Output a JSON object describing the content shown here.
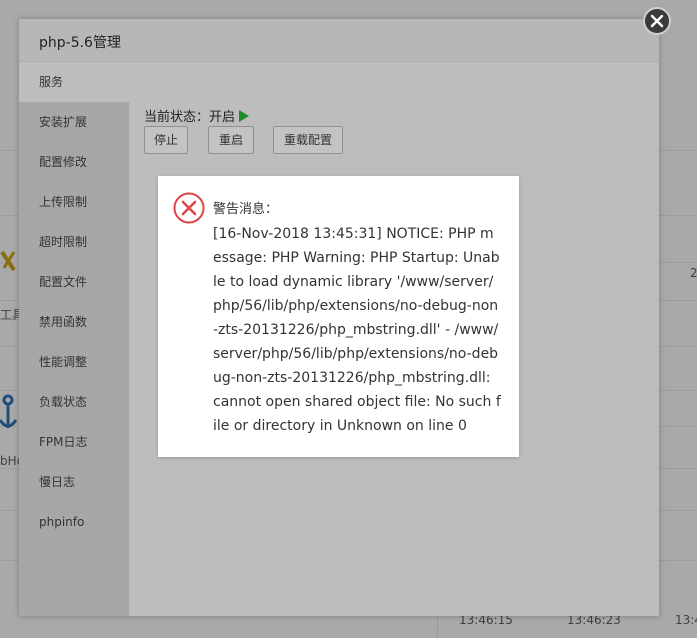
{
  "background": {
    "left_labels": [
      "工具",
      "bHo"
    ],
    "right_number": "2",
    "time_labels": [
      "13:46:15",
      "13:46:23",
      "13:4"
    ]
  },
  "modal": {
    "title": "php-5.6管理",
    "sidebar": [
      {
        "label": "服务",
        "active": true
      },
      {
        "label": "安装扩展"
      },
      {
        "label": "配置修改"
      },
      {
        "label": "上传限制"
      },
      {
        "label": "超时限制"
      },
      {
        "label": "配置文件"
      },
      {
        "label": "禁用函数"
      },
      {
        "label": "性能调整"
      },
      {
        "label": "负载状态"
      },
      {
        "label": "FPM日志"
      },
      {
        "label": "慢日志"
      },
      {
        "label": "phpinfo"
      }
    ],
    "status_text": "当前状态：开启",
    "buttons": {
      "stop": "停止",
      "restart": "重启",
      "reload": "重载配置"
    }
  },
  "alert": {
    "title": "警告消息：",
    "message": "[16-Nov-2018 13:45:31] NOTICE: PHP message: PHP Warning: PHP Startup: Unable to load dynamic library '/www/server/php/56/lib/php/extensions/no-debug-non-zts-20131226/php_mbstring.dll' - /www/server/php/56/lib/php/extensions/no-debug-non-zts-20131226/php_mbstring.dll: cannot open shared object file: No such file or directory in Unknown on line 0"
  },
  "colors": {
    "status_green": "#1d8a2c",
    "error_red": "#e04545"
  }
}
